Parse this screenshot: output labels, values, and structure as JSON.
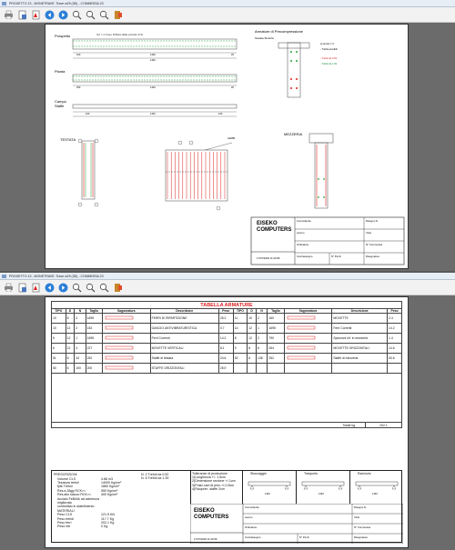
{
  "window1": {
    "title": "PROGETTO 13 - MONETRAVE: Trave w29 (3D) - COMMESSA 23",
    "sheet": {
      "labels": {
        "prospetto": "Prospetto",
        "pianta": "Pianta",
        "campo_staffe": "Campo\nStaffe",
        "testata": "TESTATA",
        "lemb": "LEMB",
        "mezzeria": "MEZZERIA"
      },
      "beam_caption": "G2 = 4 Cavo D/DHA dalla portata di St",
      "beam_dims": [
        "100",
        "1440",
        "20"
      ],
      "beam_dims_b": [
        "350",
        "1440",
        "20"
      ],
      "staffe_dims": [
        "100",
        "1440",
        "100"
      ],
      "armature_block": {
        "title": "Armature di Precompressione",
        "subtitle": "Testata Sinistra",
        "legend": [
          "a) ternari = 0",
          "- Trefoli possibili",
          "- Trefoli da 0.52",
          "- Trefoli da 1.39"
        ]
      },
      "title_block": {
        "company": "EISEKO\nCOMPUTERS",
        "date": "17/07/2020 11:20:66",
        "fields": [
          "Committente",
          "Disegno N.",
          "Lavoro",
          "Visto",
          "Ordinatore",
          "N° Commessa",
          "Contrassegno",
          "N° Pezzi",
          "Disegnatore"
        ]
      }
    }
  },
  "window2": {
    "title": "PROGETTO 13 - MONETRAVE: Trave w29 (3D) - COMMESSA 23",
    "table": {
      "title": "TABELLA ARMATURE",
      "headers_left": [
        "TIPO",
        "D",
        "N",
        "Taglio",
        "Sagomatura",
        "Descrizione",
        "Peso"
      ],
      "headers_right": [
        "TIPO",
        "D",
        "N",
        "Taglio",
        "Sagomatura",
        "Descrizione",
        "Peso"
      ],
      "rows_left": [
        [
          "10",
          "8",
          "4",
          "1695",
          "",
          "FERRI DI RIPARTIZIONE",
          "25.2"
        ],
        [
          "10",
          "12",
          "2",
          "153",
          "",
          "GANCIO ANTIVIBRATURISTICA",
          "0.7"
        ],
        [
          "5",
          "12",
          "1",
          "1695",
          "",
          "Ferri Correnti",
          "14.2"
        ],
        [
          "6",
          "12",
          "4",
          "227",
          "",
          "MOVETTE VERTICALI",
          "8.1"
        ],
        [
          "51",
          "8",
          "44",
          "252",
          "",
          "Staffe di testata",
          "24.6"
        ],
        [
          "50",
          "6",
          "100",
          "200",
          "",
          "STAFFE ORIZZONTALI",
          "25.9"
        ]
      ],
      "rows_right": [
        [
          "11",
          "10",
          "2",
          "160",
          "",
          "MOVETTE",
          "2.4"
        ],
        [
          "14",
          "12",
          "1",
          "1695",
          "",
          "Ferri Correnti",
          "14.2"
        ],
        [
          "8",
          "12",
          "2",
          "790",
          "",
          "Spezzoni inf. in mezzeria",
          "1.4"
        ],
        [
          "9",
          "8",
          "6",
          "264",
          "",
          "MOVETTE ORIZZONTALI",
          "14.6"
        ],
        [
          "52",
          "6",
          "138",
          "252",
          "",
          "Staffe di mezzeria",
          "53.6"
        ]
      ],
      "total_label": "Totale kg.",
      "total_value": "202.1"
    },
    "prescrizioni": {
      "title": "PRESCRIZIONI",
      "lines": [
        [
          "Volume CLS",
          "4.86 m3"
        ],
        [
          "Tesatura trefoli",
          "14000 Kg/cm²"
        ],
        [
          "fptk Trefoli",
          "1860 Kg/cm²"
        ],
        [
          "Res.a 28gg RCK>=",
          "550 Kg/cm²"
        ],
        [
          "Res.allo stacco RCK>=",
          "400 Kg/cm²"
        ],
        [
          "Acciaio FeB44k ad aderenza migliorata",
          ""
        ],
        [
          "controllato in stabilimento",
          ""
        ],
        [
          "MATERIALI",
          ""
        ],
        [
          "Peso CLS",
          "121.5 KN"
        ],
        [
          "Peso trefoli",
          "117.7 Kg"
        ],
        [
          "Peso ferri",
          "202.1 Kg"
        ],
        [
          "Peso reti",
          "0 Kg"
        ]
      ],
      "trefoli": [
        "N. 2 Trefoli da  0.52",
        "N. 6 Trefoli da  1.39"
      ],
      "tolleranze": [
        "Tolleranze di produzione",
        "1)Lunghezza +/- 1.5cm",
        "2)Dimensione sezione +/-1cm",
        "3)Posiz.cavi di prec.+/-0.5cm",
        "4)Ricoprim. staffe 2cm"
      ]
    },
    "phases": [
      "Stoccaggio",
      "Trasporto",
      "Esercizio"
    ],
    "phase_dims": [
      "1440",
      "1440",
      "1440"
    ],
    "title_block": {
      "company": "EISEKO\nCOMPUTERS",
      "date": "17/07/2020 11:20:66",
      "fields": [
        "Committente",
        "Disegno N.",
        "Lavoro",
        "Visto",
        "Ordinatore",
        "N° Commessa",
        "Contrassegno",
        "N° Pezzi",
        "Disegnatore"
      ]
    }
  },
  "toolbar": {
    "buttons": [
      "print-icon",
      "page-setup-icon",
      "pdf-icon",
      "prev-icon",
      "next-icon",
      "zoom-in-icon",
      "zoom-out-icon",
      "zoom-fit-icon",
      "exit-icon"
    ]
  }
}
